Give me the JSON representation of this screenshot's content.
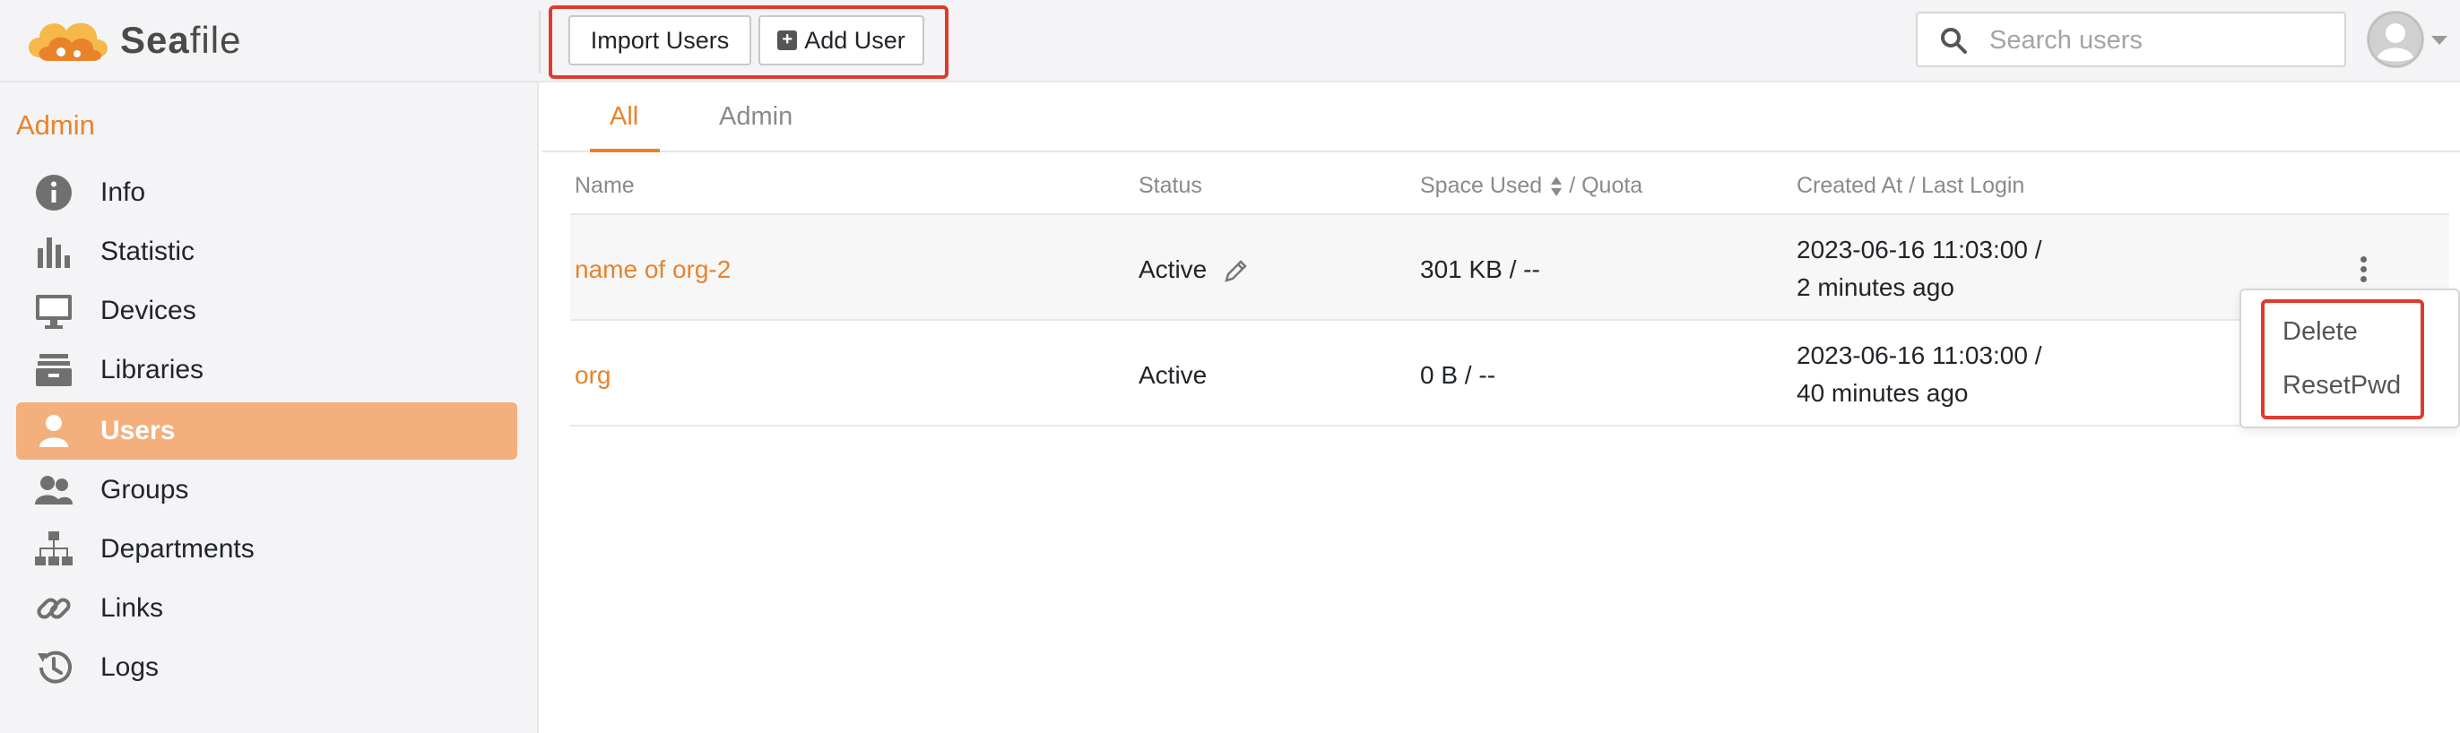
{
  "app": {
    "logo_text_a": "Sea",
    "logo_text_b": "file"
  },
  "toolbar": {
    "import_label": "Import Users",
    "add_label": "Add User"
  },
  "search": {
    "placeholder": "Search users"
  },
  "sidebar": {
    "heading": "Admin",
    "items": [
      {
        "label": "Info",
        "icon": "info-icon"
      },
      {
        "label": "Statistic",
        "icon": "bar-chart-icon"
      },
      {
        "label": "Devices",
        "icon": "monitor-icon"
      },
      {
        "label": "Libraries",
        "icon": "archive-icon"
      },
      {
        "label": "Users",
        "icon": "user-icon",
        "active": true
      },
      {
        "label": "Groups",
        "icon": "group-icon"
      },
      {
        "label": "Departments",
        "icon": "org-chart-icon"
      },
      {
        "label": "Links",
        "icon": "link-icon"
      },
      {
        "label": "Logs",
        "icon": "history-icon"
      }
    ]
  },
  "tabs": [
    {
      "label": "All",
      "active": true
    },
    {
      "label": "Admin",
      "active": false
    }
  ],
  "table": {
    "headers": {
      "name": "Name",
      "status": "Status",
      "space_a": "Space Used",
      "space_b": "/ Quota",
      "created": "Created At / Last Login"
    },
    "rows": [
      {
        "name": "name of org-2",
        "status": "Active",
        "space": "301 KB / --",
        "created": "2023-06-16 11:03:00 /",
        "last_login": "2 minutes ago"
      },
      {
        "name": "org",
        "status": "Active",
        "space": "0 B / --",
        "created": "2023-06-16 11:03:00 /",
        "last_login": "40 minutes ago"
      }
    ]
  },
  "dropdown": {
    "items": [
      "Delete",
      "ResetPwd"
    ]
  },
  "colors": {
    "accent": "#e8832a",
    "active_nav": "#f3b07d",
    "highlight_box": "#e03a2c"
  }
}
